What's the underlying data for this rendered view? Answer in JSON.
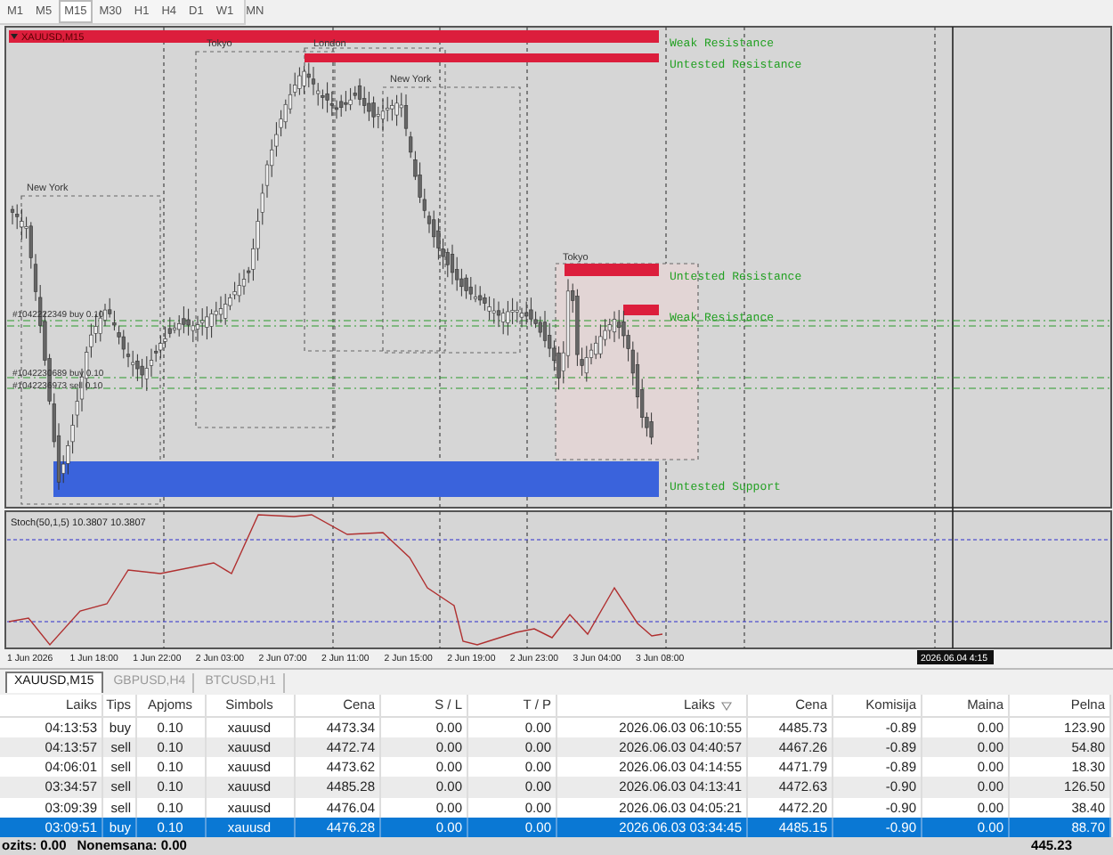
{
  "timeframes": [
    {
      "label": "M1",
      "selected": false
    },
    {
      "label": "M5",
      "selected": false
    },
    {
      "label": "M15",
      "selected": true
    },
    {
      "label": "M30",
      "selected": false
    },
    {
      "label": "H1",
      "selected": false
    },
    {
      "label": "H4",
      "selected": false
    },
    {
      "label": "D1",
      "selected": false
    },
    {
      "label": "W1",
      "selected": false
    },
    {
      "label": "MN",
      "selected": false
    }
  ],
  "chart": {
    "title": "XAUUSD,M15",
    "sessions": [
      {
        "label": "Tokyo"
      },
      {
        "label": "London"
      },
      {
        "label": "New York"
      },
      {
        "label": "New York"
      },
      {
        "label": "Tokyo"
      }
    ],
    "zones": [
      {
        "label": "Weak Resistance",
        "kind": "resistance"
      },
      {
        "label": "Untested Resistance",
        "kind": "resistance"
      },
      {
        "label": "Untested Resistance",
        "kind": "resistance"
      },
      {
        "label": "Weak Resistance",
        "kind": "resistance"
      },
      {
        "label": "Untested Support",
        "kind": "support"
      }
    ],
    "order_labels": [
      "#1042222349 buy 0.10",
      "#1042230689 buy 0.10",
      "#1042236973 sell 0.10"
    ],
    "indicator": "Stoch(50,1,5) 10.3807 10.3807",
    "time_axis": [
      "1 Jun 2026",
      "1 Jun 18:00",
      "1 Jun 22:00",
      "2 Jun 03:00",
      "2 Jun 07:00",
      "2 Jun 11:00",
      "2 Jun 15:00",
      "2 Jun 19:00",
      "2 Jun 23:00",
      "3 Jun 04:00",
      "3 Jun 08:00"
    ],
    "cursor_time": "2026.06.04 4:15"
  },
  "symbol_tabs": [
    {
      "label": "XAUUSD,M15",
      "selected": true
    },
    {
      "label": "GBPUSD,H4",
      "selected": false
    },
    {
      "label": "BTCUSD,H1",
      "selected": false
    }
  ],
  "table": {
    "columns": [
      {
        "label": "Laiks",
        "sorted": false
      },
      {
        "label": "Tips",
        "sorted": false
      },
      {
        "label": "Apjoms",
        "sorted": false
      },
      {
        "label": "Simbols",
        "sorted": false
      },
      {
        "label": "Cena",
        "sorted": false
      },
      {
        "label": "S / L",
        "sorted": false
      },
      {
        "label": "T / P",
        "sorted": false
      },
      {
        "label": "Laiks",
        "sorted": true
      },
      {
        "label": "Cena",
        "sorted": false
      },
      {
        "label": "Komisija",
        "sorted": false
      },
      {
        "label": "Maina",
        "sorted": false
      },
      {
        "label": "Pelna",
        "sorted": false
      }
    ],
    "rows": [
      {
        "cells": [
          "04:13:53",
          "buy",
          "0.10",
          "xauusd",
          "4473.34",
          "0.00",
          "0.00",
          "2026.06.03 06:10:55",
          "4485.73",
          "-0.89",
          "0.00",
          "123.90"
        ],
        "selected": false
      },
      {
        "cells": [
          "04:13:57",
          "sell",
          "0.10",
          "xauusd",
          "4472.74",
          "0.00",
          "0.00",
          "2026.06.03 04:40:57",
          "4467.26",
          "-0.89",
          "0.00",
          "54.80"
        ],
        "selected": false
      },
      {
        "cells": [
          "04:06:01",
          "sell",
          "0.10",
          "xauusd",
          "4473.62",
          "0.00",
          "0.00",
          "2026.06.03 04:14:55",
          "4471.79",
          "-0.89",
          "0.00",
          "18.30"
        ],
        "selected": false
      },
      {
        "cells": [
          "03:34:57",
          "sell",
          "0.10",
          "xauusd",
          "4485.28",
          "0.00",
          "0.00",
          "2026.06.03 04:13:41",
          "4472.63",
          "-0.90",
          "0.00",
          "126.50"
        ],
        "selected": false
      },
      {
        "cells": [
          "03:09:39",
          "sell",
          "0.10",
          "xauusd",
          "4476.04",
          "0.00",
          "0.00",
          "2026.06.03 04:05:21",
          "4472.20",
          "-0.90",
          "0.00",
          "38.40"
        ],
        "selected": false
      },
      {
        "cells": [
          "03:09:51",
          "buy",
          "0.10",
          "xauusd",
          "4476.28",
          "0.00",
          "0.00",
          "2026.06.03 03:34:45",
          "4485.15",
          "-0.90",
          "0.00",
          "88.70"
        ],
        "selected": true
      }
    ]
  },
  "footer": {
    "deposit": "ozits: 0.00",
    "margin": "Nonemsana: 0.00",
    "total": "445.23"
  }
}
